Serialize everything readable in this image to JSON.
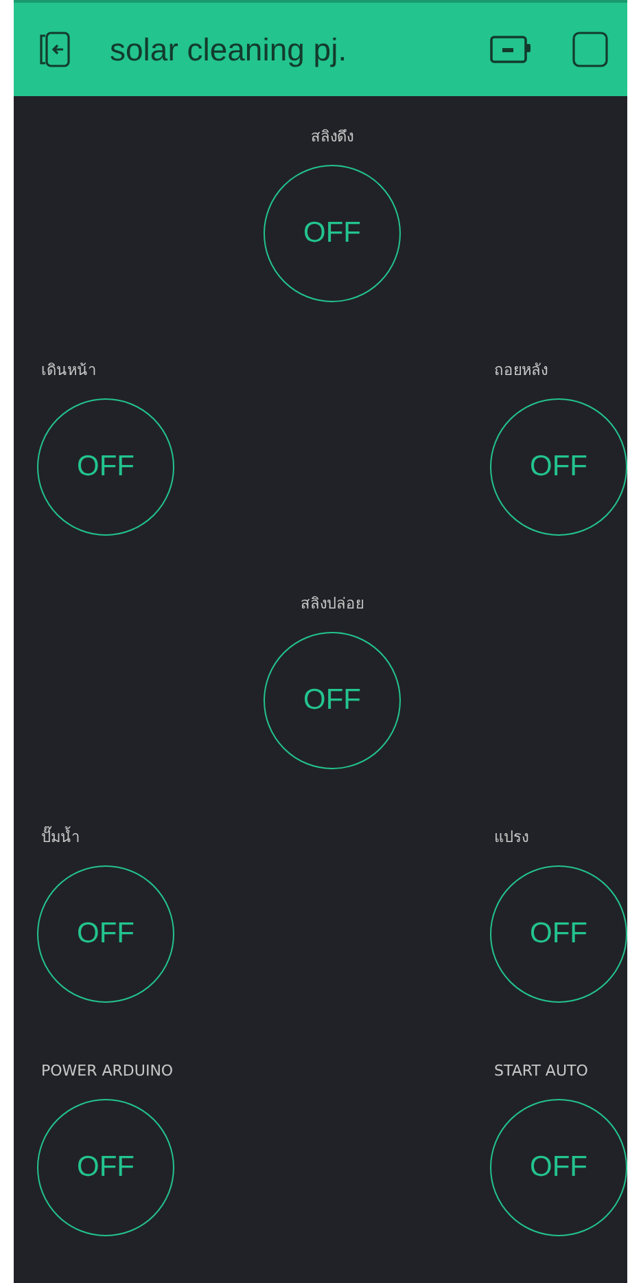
{
  "header": {
    "title": "solar cleaning pj."
  },
  "rows": [
    {
      "center": {
        "label": "สลิงดึง",
        "on": false,
        "state_text": "OFF"
      }
    },
    {
      "left": {
        "label": "เดินหน้า",
        "on": false,
        "state_text": "OFF"
      },
      "right": {
        "label": "ถอยหลัง",
        "on": false,
        "state_text": "OFF"
      }
    },
    {
      "center": {
        "label": "สลิงปล่อย",
        "on": false,
        "state_text": "OFF"
      }
    },
    {
      "left": {
        "label": "ปั๊มน้ำ",
        "on": false,
        "state_text": "OFF"
      },
      "right": {
        "label": "แปรง",
        "on": false,
        "state_text": "OFF"
      }
    },
    {
      "left": {
        "label": "POWER ARDUINO",
        "on": false,
        "state_text": "OFF"
      },
      "right": {
        "label": "START AUTO",
        "on": false,
        "state_text": "OFF"
      }
    }
  ]
}
